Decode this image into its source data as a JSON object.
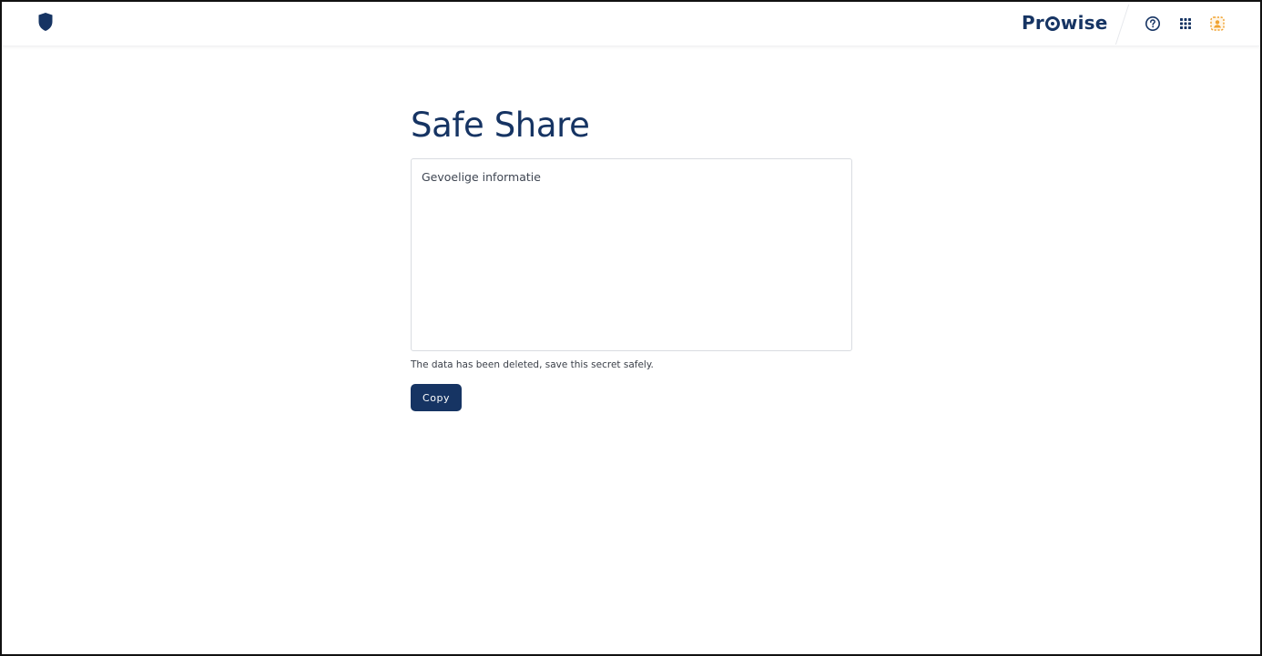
{
  "header": {
    "app_icon": "shield-icon",
    "brand": {
      "prefix": "Pr",
      "suffix": "wise",
      "color": "#163463"
    },
    "icons": [
      "help-circle-icon",
      "apps-grid-icon",
      "user-avatar-icon"
    ]
  },
  "main": {
    "title": "Safe Share",
    "secret_text": "Gevoelige informatie",
    "notice": "The data has been deleted, save this secret safely.",
    "copy_label": "Copy"
  },
  "colors": {
    "brand": "#163463",
    "avatar_accent": "#f0a230"
  }
}
